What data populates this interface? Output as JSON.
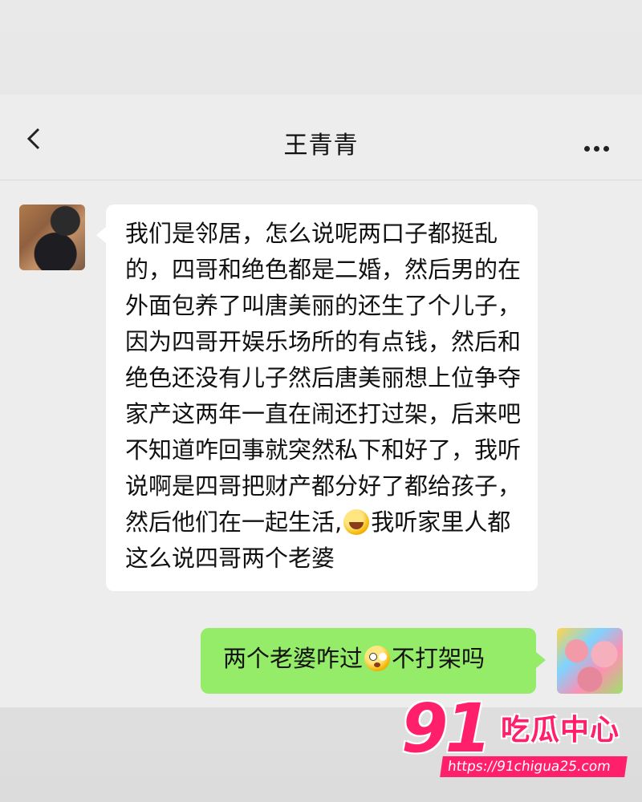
{
  "header": {
    "title": "王青青",
    "back_icon": "chevron-left-icon",
    "more_icon": "more-horizontal-icon"
  },
  "messages": [
    {
      "side": "left",
      "avatar": "user-photo-avatar",
      "part1": "我们是邻居，怎么说呢两口子都挺乱的，四哥和绝色都是二婚，然后男的在外面包养了叫唐美丽的还生了个儿子，因为四哥开娱乐场所的有点钱，然后和绝色还没有儿子然后唐美丽想上位争夺家产这两年一直在闹还打过架，后来吧不知道咋回事就突然私下和好了，我听说啊是四哥把财产都分好了都给孩子，然后他们在一起生活,",
      "emoji": "laughing-emoji",
      "part2": "我听家里人都这么说四哥两个老婆"
    },
    {
      "side": "right",
      "avatar": "cartoon-avatar",
      "part1": "两个老婆咋过",
      "emoji": "shocked-emoji",
      "part2": "不打架吗"
    }
  ],
  "watermark": {
    "logo_number": "91",
    "brand": "吃瓜中心",
    "url": "https://91chigua25.com"
  },
  "colors": {
    "background": "#ededed",
    "bubble_self": "#95ec69",
    "bubble_other": "#ffffff",
    "watermark": "#ff1f6b"
  }
}
